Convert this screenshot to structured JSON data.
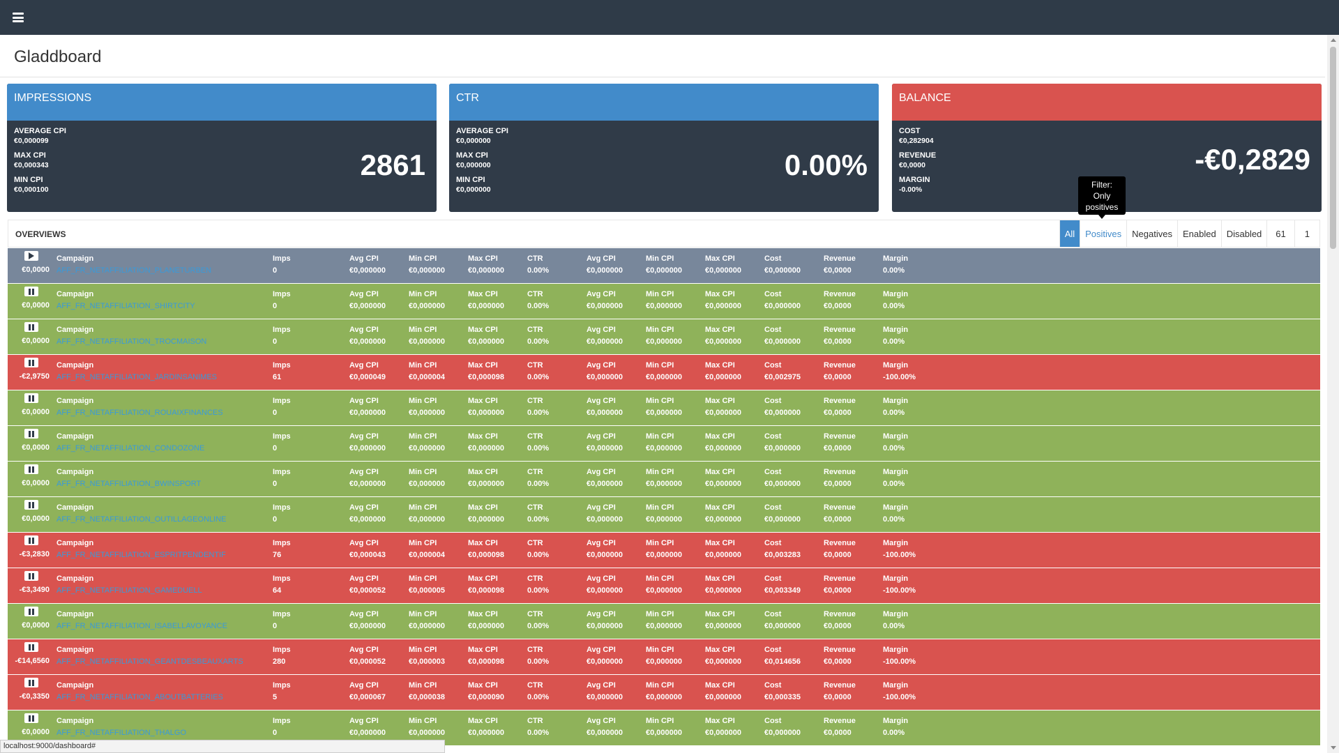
{
  "app_title": "Gladdboard",
  "colors": {
    "topbar": "#2f3b48",
    "blue": "#428bca",
    "red": "#d9534f",
    "green": "#8fb25a",
    "gray": "#78879b"
  },
  "icons": {
    "menu": "hamburger-icon",
    "play": "play-icon",
    "pause": "pause-icon"
  },
  "cards": [
    {
      "title": "IMPRESSIONS",
      "header_color": "#428bca",
      "metrics": [
        {
          "label": "AVERAGE CPI",
          "value": "€0,000099"
        },
        {
          "label": "MAX CPI",
          "value": "€0,000343"
        },
        {
          "label": "MIN CPI",
          "value": "€0,000100"
        }
      ],
      "big_value": "2861"
    },
    {
      "title": "CTR",
      "header_color": "#428bca",
      "metrics": [
        {
          "label": "AVERAGE CPI",
          "value": "€0,000000"
        },
        {
          "label": "MAX CPI",
          "value": "€0,000000"
        },
        {
          "label": "MIN CPI",
          "value": "€0,000000"
        }
      ],
      "big_value": "0.00%"
    },
    {
      "title": "BALANCE",
      "header_color": "#d9534f",
      "metrics": [
        {
          "label": "COST",
          "value": "€0,282904"
        },
        {
          "label": "REVENUE",
          "value": "€0,0000"
        },
        {
          "label": "MARGIN",
          "value": "-0.00%"
        }
      ],
      "big_value": "-€0,2829"
    }
  ],
  "tooltip": {
    "text_1": "Filter:",
    "text_2": "Only",
    "text_3": "positives"
  },
  "overview": {
    "title": "OVERVIEWS",
    "filters": {
      "all": "All",
      "positives": "Positives",
      "negatives": "Negatives",
      "enabled": "Enabled",
      "disabled": "Disabled",
      "count": "61",
      "page": "1"
    }
  },
  "labels": {
    "campaign": "Campaign",
    "imps": "Imps",
    "avg_cpi": "Avg CPI",
    "min_cpi": "Min CPI",
    "max_cpi": "Max CPI",
    "ctr": "CTR",
    "cost": "Cost",
    "revenue": "Revenue",
    "margin": "Margin"
  },
  "rows": [
    {
      "status": "play",
      "color": "gray",
      "balance": "€0,0000",
      "campaign": "AFF_FR_NETAFFILIATION_PLANETURBEN",
      "imps": "0",
      "avg_cpi": "€0,000000",
      "min_cpi": "€0,000000",
      "max_cpi": "€0,000000",
      "ctr": "0.00%",
      "avg_cpi2": "€0,000000",
      "min_cpi2": "€0,000000",
      "max_cpi2": "€0,000000",
      "cost": "€0,000000",
      "revenue": "€0,0000",
      "margin": "0.00%"
    },
    {
      "status": "pause",
      "color": "green",
      "balance": "€0,0000",
      "campaign": "AFF_FR_NETAFFILIATION_SHIRTCITY",
      "imps": "0",
      "avg_cpi": "€0,000000",
      "min_cpi": "€0,000000",
      "max_cpi": "€0,000000",
      "ctr": "0.00%",
      "avg_cpi2": "€0,000000",
      "min_cpi2": "€0,000000",
      "max_cpi2": "€0,000000",
      "cost": "€0,000000",
      "revenue": "€0,0000",
      "margin": "0.00%"
    },
    {
      "status": "pause",
      "color": "green",
      "balance": "€0,0000",
      "campaign": "AFF_FR_NETAFFILIATION_TROCMAISON",
      "imps": "0",
      "avg_cpi": "€0,000000",
      "min_cpi": "€0,000000",
      "max_cpi": "€0,000000",
      "ctr": "0.00%",
      "avg_cpi2": "€0,000000",
      "min_cpi2": "€0,000000",
      "max_cpi2": "€0,000000",
      "cost": "€0,000000",
      "revenue": "€0,0000",
      "margin": "0.00%"
    },
    {
      "status": "pause",
      "color": "red",
      "balance": "-€2,9750",
      "campaign": "AFF_FR_NETAFFILIATION_JARDINSANIMES",
      "imps": "61",
      "avg_cpi": "€0,000049",
      "min_cpi": "€0,000004",
      "max_cpi": "€0,000098",
      "ctr": "0.00%",
      "avg_cpi2": "€0,000000",
      "min_cpi2": "€0,000000",
      "max_cpi2": "€0,000000",
      "cost": "€0,002975",
      "revenue": "€0,0000",
      "margin": "-100.00%"
    },
    {
      "status": "pause",
      "color": "green",
      "balance": "€0,0000",
      "campaign": "AFF_FR_NETAFFILIATION_ROUAIXFINANCES",
      "imps": "0",
      "avg_cpi": "€0,000000",
      "min_cpi": "€0,000000",
      "max_cpi": "€0,000000",
      "ctr": "0.00%",
      "avg_cpi2": "€0,000000",
      "min_cpi2": "€0,000000",
      "max_cpi2": "€0,000000",
      "cost": "€0,000000",
      "revenue": "€0,0000",
      "margin": "0.00%"
    },
    {
      "status": "pause",
      "color": "green",
      "balance": "€0,0000",
      "campaign": "AFF_FR_NETAFFILIATION_CONDOZONE",
      "imps": "0",
      "avg_cpi": "€0,000000",
      "min_cpi": "€0,000000",
      "max_cpi": "€0,000000",
      "ctr": "0.00%",
      "avg_cpi2": "€0,000000",
      "min_cpi2": "€0,000000",
      "max_cpi2": "€0,000000",
      "cost": "€0,000000",
      "revenue": "€0,0000",
      "margin": "0.00%"
    },
    {
      "status": "pause",
      "color": "green",
      "balance": "€0,0000",
      "campaign": "AFF_FR_NETAFFILIATION_BWINSPORT",
      "imps": "0",
      "avg_cpi": "€0,000000",
      "min_cpi": "€0,000000",
      "max_cpi": "€0,000000",
      "ctr": "0.00%",
      "avg_cpi2": "€0,000000",
      "min_cpi2": "€0,000000",
      "max_cpi2": "€0,000000",
      "cost": "€0,000000",
      "revenue": "€0,0000",
      "margin": "0.00%"
    },
    {
      "status": "pause",
      "color": "green",
      "balance": "€0,0000",
      "campaign": "AFF_FR_NETAFFILIATION_OUTILLAGEONLINE",
      "imps": "0",
      "avg_cpi": "€0,000000",
      "min_cpi": "€0,000000",
      "max_cpi": "€0,000000",
      "ctr": "0.00%",
      "avg_cpi2": "€0,000000",
      "min_cpi2": "€0,000000",
      "max_cpi2": "€0,000000",
      "cost": "€0,000000",
      "revenue": "€0,0000",
      "margin": "0.00%"
    },
    {
      "status": "pause",
      "color": "red",
      "balance": "-€3,2830",
      "campaign": "AFF_FR_NETAFFILIATION_ESPRITPENDENTIF",
      "imps": "76",
      "avg_cpi": "€0,000043",
      "min_cpi": "€0,000004",
      "max_cpi": "€0,000098",
      "ctr": "0.00%",
      "avg_cpi2": "€0,000000",
      "min_cpi2": "€0,000000",
      "max_cpi2": "€0,000000",
      "cost": "€0,003283",
      "revenue": "€0,0000",
      "margin": "-100.00%"
    },
    {
      "status": "pause",
      "color": "red",
      "balance": "-€3,3490",
      "campaign": "AFF_FR_NETAFFILIATION_GAMEDUELL",
      "imps": "64",
      "avg_cpi": "€0,000052",
      "min_cpi": "€0,000005",
      "max_cpi": "€0,000098",
      "ctr": "0.00%",
      "avg_cpi2": "€0,000000",
      "min_cpi2": "€0,000000",
      "max_cpi2": "€0,000000",
      "cost": "€0,003349",
      "revenue": "€0,0000",
      "margin": "-100.00%"
    },
    {
      "status": "pause",
      "color": "green",
      "balance": "€0,0000",
      "campaign": "AFF_FR_NETAFFILIATION_ISABELLAVOYANCE",
      "imps": "0",
      "avg_cpi": "€0,000000",
      "min_cpi": "€0,000000",
      "max_cpi": "€0,000000",
      "ctr": "0.00%",
      "avg_cpi2": "€0,000000",
      "min_cpi2": "€0,000000",
      "max_cpi2": "€0,000000",
      "cost": "€0,000000",
      "revenue": "€0,0000",
      "margin": "0.00%"
    },
    {
      "status": "pause",
      "color": "red",
      "balance": "-€14,6560",
      "campaign": "AFF_FR_NETAFFILIATION_GEANTDESBEAUXARTS",
      "imps": "280",
      "avg_cpi": "€0,000052",
      "min_cpi": "€0,000003",
      "max_cpi": "€0,000098",
      "ctr": "0.00%",
      "avg_cpi2": "€0,000000",
      "min_cpi2": "€0,000000",
      "max_cpi2": "€0,000000",
      "cost": "€0,014656",
      "revenue": "€0,0000",
      "margin": "-100.00%"
    },
    {
      "status": "pause",
      "color": "red",
      "balance": "-€0,3350",
      "campaign": "AFF_FR_NETAFFILIATION_ABOUTBATTERIES",
      "imps": "5",
      "avg_cpi": "€0,000067",
      "min_cpi": "€0,000038",
      "max_cpi": "€0,000090",
      "ctr": "0.00%",
      "avg_cpi2": "€0,000000",
      "min_cpi2": "€0,000000",
      "max_cpi2": "€0,000000",
      "cost": "€0,000335",
      "revenue": "€0,0000",
      "margin": "-100.00%"
    },
    {
      "status": "pause",
      "color": "green",
      "balance": "€0,0000",
      "campaign": "AFF_FR_NETAFFILIATION_THALGO",
      "imps": "0",
      "avg_cpi": "€0,000000",
      "min_cpi": "€0,000000",
      "max_cpi": "€0,000000",
      "ctr": "0.00%",
      "avg_cpi2": "€0,000000",
      "min_cpi2": "€0,000000",
      "max_cpi2": "€0,000000",
      "cost": "€0,000000",
      "revenue": "€0,0000",
      "margin": "0.00%"
    }
  ],
  "status_url": "localhost:9000/dashboard#"
}
